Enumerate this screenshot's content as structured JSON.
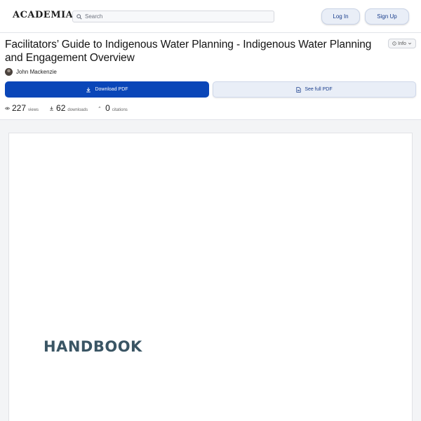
{
  "header": {
    "logo": "ACADEMIA",
    "search_placeholder": "Search",
    "login_label": "Log In",
    "signup_label": "Sign Up"
  },
  "paper": {
    "title": "Facilitators’ Guide to Indigenous Water Planning - Indigenous Water Planning and Engagement Overview",
    "info_label": "Info",
    "author": "John Mackenzie"
  },
  "actions": {
    "download_label": "Download PDF",
    "see_full_label": "See full PDF"
  },
  "stats": {
    "views": "227",
    "views_label": "views",
    "downloads": "62",
    "downloads_label": "downloads",
    "citations": "0",
    "citations_label": "citations"
  },
  "document": {
    "page_heading": "HANDBOOK"
  },
  "colors": {
    "primary": "#0a46b8",
    "secondary_bg": "#e9eef7",
    "heading": "#3a5564"
  }
}
